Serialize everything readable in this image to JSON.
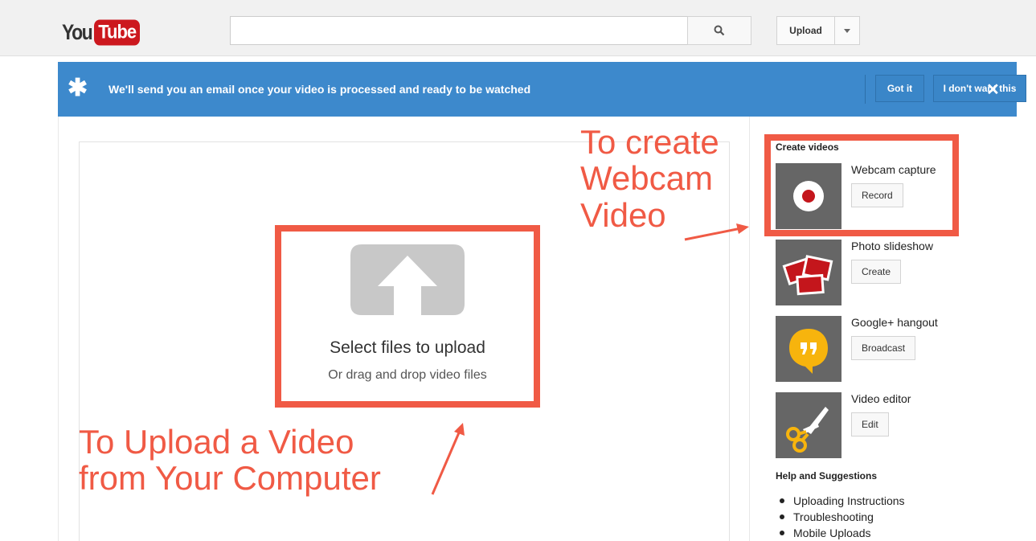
{
  "header": {
    "logo_you": "You",
    "logo_tube": "Tube",
    "search_placeholder": "",
    "upload_label": "Upload"
  },
  "notice": {
    "message": "We'll send you an email once your video is processed and ready to be watched",
    "got_it_label": "Got it",
    "dont_want_label": "I don't want this",
    "star_glyph": "✱",
    "close_glyph": "✕"
  },
  "upload": {
    "title": "Select files to upload",
    "subtitle": "Or drag and drop video files"
  },
  "annotations": {
    "webcam_lines": [
      "To create",
      "Webcam",
      "Video"
    ],
    "upload_lines": [
      "To Upload a Video",
      "from Your Computer"
    ]
  },
  "sidebar": {
    "create_heading": "Create videos",
    "tools": [
      {
        "name": "Webcam capture",
        "button": "Record",
        "icon": "webcam-record-icon"
      },
      {
        "name": "Photo slideshow",
        "button": "Create",
        "icon": "photo-slideshow-icon"
      },
      {
        "name": "Google+ hangout",
        "button": "Broadcast",
        "icon": "hangout-icon"
      },
      {
        "name": "Video editor",
        "button": "Edit",
        "icon": "scissors-icon"
      }
    ],
    "help_heading": "Help and Suggestions",
    "help_links": [
      "Uploading Instructions",
      "Troubleshooting",
      "Mobile Uploads"
    ]
  },
  "colors": {
    "brand_red": "#cc181e",
    "notice_blue": "#3d89cc",
    "annotation_red": "#f05a45"
  }
}
